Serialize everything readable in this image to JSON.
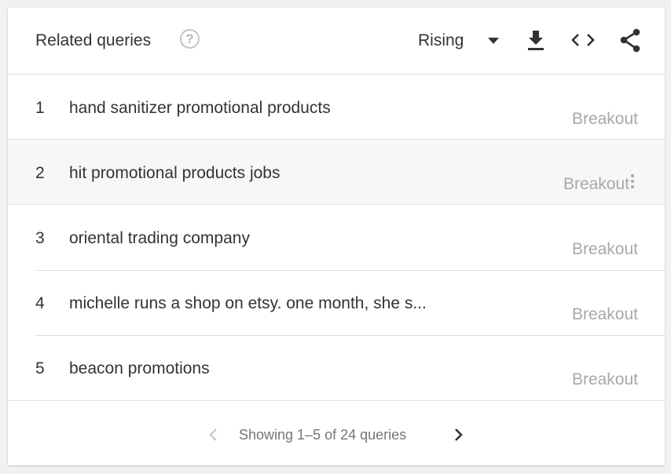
{
  "header": {
    "title": "Related queries",
    "help_glyph": "?",
    "sort_value": "Rising"
  },
  "icons": {
    "help": "help-circle-icon",
    "dropdown": "caret-down-icon",
    "download": "download-icon",
    "embed": "code-icon",
    "share": "share-icon",
    "menu": "kebab-menu-icon",
    "prev": "chevron-left-icon",
    "next": "chevron-right-icon"
  },
  "rows": [
    {
      "rank": "1",
      "query": "hand sanitizer promotional products",
      "value": "Breakout"
    },
    {
      "rank": "2",
      "query": "hit promotional products jobs",
      "value": "Breakout"
    },
    {
      "rank": "3",
      "query": "oriental trading company",
      "value": "Breakout"
    },
    {
      "rank": "4",
      "query": "michelle runs a shop on etsy. one month, she s...",
      "value": "Breakout"
    },
    {
      "rank": "5",
      "query": "beacon promotions",
      "value": "Breakout"
    }
  ],
  "pager": {
    "text": "Showing 1–5 of 24 queries"
  },
  "colors": {
    "text": "#333333",
    "muted": "#a8a8a8",
    "icon_dark": "#333333",
    "icon_disabled": "#c7c7c7"
  }
}
